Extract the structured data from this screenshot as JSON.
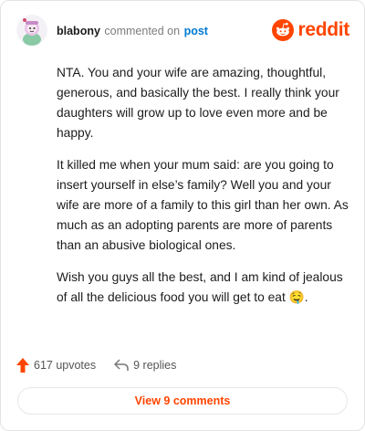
{
  "header": {
    "username": "blabony",
    "action_text": "commented on",
    "post_link": "post",
    "brand": "reddit"
  },
  "comment": {
    "paragraphs": [
      "NTA. You and your wife are amazing, thoughtful, generous, and basically the best. I really think your daughters will grow up to love even more and be happy.",
      "It killed me when your mum said: are you going to insert yourself in else’s family? Well you and your wife are more of a family to this girl than her own. As much as an adopting parents are more of parents than an abusive biological ones.",
      "Wish you guys all the best, and I am kind of jealous of all the delicious food you will get to eat 🤤."
    ]
  },
  "footer": {
    "upvotes": "617 upvotes",
    "replies": "9 replies",
    "view_comments": "View 9 comments"
  },
  "colors": {
    "brand": "#ff4500",
    "link": "#0079d3",
    "muted": "#7c7c7c"
  }
}
